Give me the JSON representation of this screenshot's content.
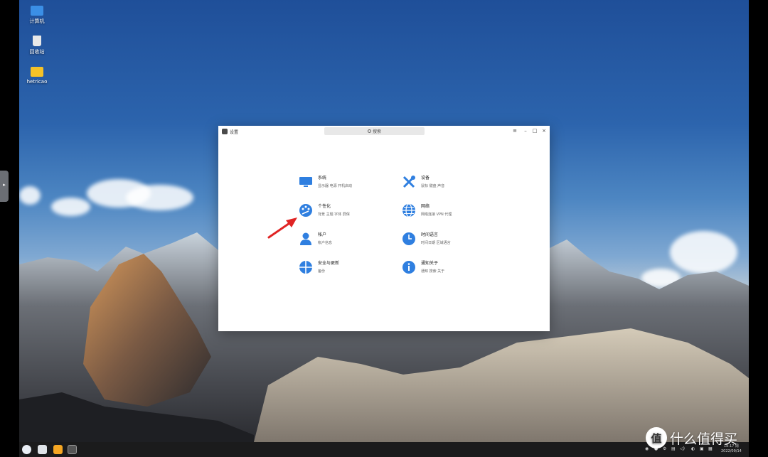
{
  "desktop": {
    "icons": [
      {
        "label": "计算机",
        "icon": "computer-icon",
        "color": "#3b8fe6"
      },
      {
        "label": "回收站",
        "icon": "trash-icon",
        "color": "#e8e8e8"
      },
      {
        "label": "hetricao",
        "icon": "folder-icon",
        "color": "#f5c227"
      }
    ]
  },
  "side_handle": {
    "glyph": "▸"
  },
  "window": {
    "title": "设置",
    "search_placeholder": "搜索",
    "controls": {
      "menu": "≡",
      "minimize": "–",
      "maximize": "□",
      "close": "×"
    },
    "accent_color": "#2f7fe0",
    "items": [
      {
        "title": "系统",
        "sub": "显示器  电源  开机启动",
        "icon": "monitor-icon"
      },
      {
        "title": "设备",
        "sub": "鼠标  键盘  声音",
        "icon": "tools-icon"
      },
      {
        "title": "个性化",
        "sub": "背景  主题  字体  屏保",
        "icon": "palette-icon"
      },
      {
        "title": "网络",
        "sub": "网络连接  VPN  代理",
        "icon": "globe-icon"
      },
      {
        "title": "帐户",
        "sub": "帐户信息",
        "icon": "user-icon"
      },
      {
        "title": "时间语言",
        "sub": "时间日期  区域语言",
        "icon": "clock-icon"
      },
      {
        "title": "安全与更新",
        "sub": "备份",
        "icon": "shield-icon"
      },
      {
        "title": "通知关于",
        "sub": "通知  搜索  关于",
        "icon": "info-icon"
      }
    ]
  },
  "annotation": {
    "arrow_color": "#e02424"
  },
  "taskbar": {
    "tray": [
      "◉",
      "●",
      "⚙",
      "▤",
      "◁)",
      "◐",
      "▣",
      "▦"
    ],
    "time": "18:17 周",
    "date": "2022/09/14"
  },
  "watermark": {
    "badge": "值",
    "text": "什么值得买"
  }
}
